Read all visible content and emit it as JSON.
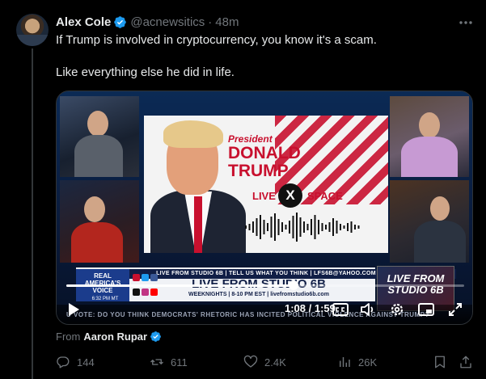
{
  "post": {
    "author_name": "Alex Cole",
    "author_handle": "@acnewsitics",
    "separator": "·",
    "time": "48m",
    "text_line1": "If Trump is involved in cryptocurrency, you know it's a scam.",
    "text_line2": "Like everything else he did in life."
  },
  "media": {
    "graphic": {
      "president": "President",
      "first_name": "DONALD",
      "last_name": "TRUMP",
      "live": "LIVE",
      "x_mark": "X",
      "space": "SPACE"
    },
    "lower_third": {
      "top_line": "LIVE FROM STUDIO 6B | TELL US WHAT YOU THINK | LFS6B@YAHOO.COM",
      "brand": "REAL AMERICA'S VOICE",
      "brand_time": "6:32 PM MT",
      "title": "LIVE FROM STUDIO 6B",
      "subtitle": "WEEKNIGHTS | 8-10 PM EST | livefromstudio6b.com",
      "logo_line1": "LIVE FROM",
      "logo_line2": "STUDIO 6B",
      "ticker": "U VOTE: DO YOU THINK DEMOCRATS' RHETORIC HAS INCITED POLITICAL VIOLENCE AGAINST TRUMP?"
    },
    "player": {
      "current_time": "1:08",
      "duration": "1:59",
      "timecode": "1:08 / 1:59",
      "progress_fraction": 0.571
    }
  },
  "from": {
    "label": "From",
    "name": "Aaron Rupar"
  },
  "actions": {
    "replies": "144",
    "reposts": "611",
    "likes": "2.4K",
    "views": "26K"
  },
  "colors": {
    "background": "#000000",
    "text": "#e7e9ea",
    "muted": "#71767b",
    "verified": "#1d9bf0",
    "accent_red": "#c8102e"
  },
  "icons": [
    "verified-badge-icon",
    "more-icon",
    "play-icon",
    "captions-icon",
    "volume-icon",
    "settings-icon",
    "pip-icon",
    "fullscreen-icon",
    "reply-icon",
    "repost-icon",
    "like-icon",
    "views-icon",
    "bookmark-icon",
    "share-icon"
  ]
}
